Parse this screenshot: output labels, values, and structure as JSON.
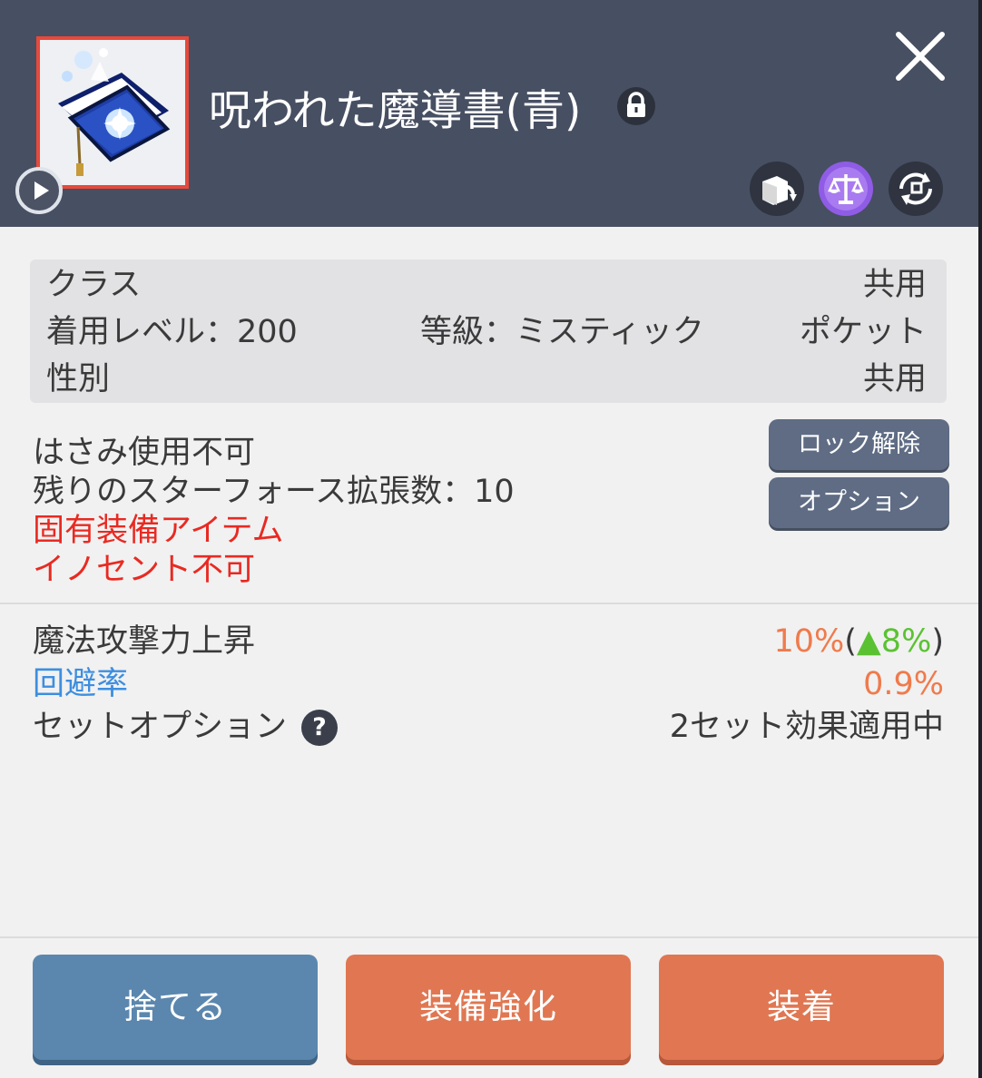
{
  "item": {
    "name": "呪われた魔導書(青)",
    "locked": true
  },
  "header_icons": [
    "play-icon",
    "lock-icon",
    "close-icon",
    "transfer-icon",
    "scale-icon",
    "cycle-icon"
  ],
  "info": {
    "class_label": "クラス",
    "class_value": "共用",
    "level_label": "着用レベル：200",
    "grade_label": "等級：ミスティック",
    "slot_value": "ポケット",
    "gender_label": "性別",
    "gender_value": "共用"
  },
  "notes": {
    "scissors": "はさみ使用不可",
    "starforce": "残りのスターフォース拡張数：10",
    "unique": "固有装備アイテム",
    "innocent": "イノセント不可"
  },
  "side_buttons": {
    "unlock": "ロック解除",
    "option": "オプション"
  },
  "stats": {
    "magic_attack_label": "魔法攻撃力上昇",
    "magic_attack_value": "10%",
    "magic_attack_open": "(",
    "magic_attack_delta": "▲8%",
    "magic_attack_close": ")",
    "evasion_label": "回避率",
    "evasion_value": "0.9%",
    "set_option_label": "セットオプション",
    "help_glyph": "?",
    "set_option_value": "2セット効果適用中"
  },
  "bottom_buttons": {
    "discard": "捨てる",
    "enhance": "装備強化",
    "equip": "装着"
  },
  "colors": {
    "header_bg": "#474f62",
    "panel_bg": "#f1f1f1",
    "red_text": "#e82a22",
    "blue_text": "#3d8ee0",
    "orange_text": "#f07a4c",
    "green_text": "#5ac232",
    "discard_button": "#5b87ae",
    "action_button": "#e07752",
    "frame_red": "#e8483a"
  }
}
